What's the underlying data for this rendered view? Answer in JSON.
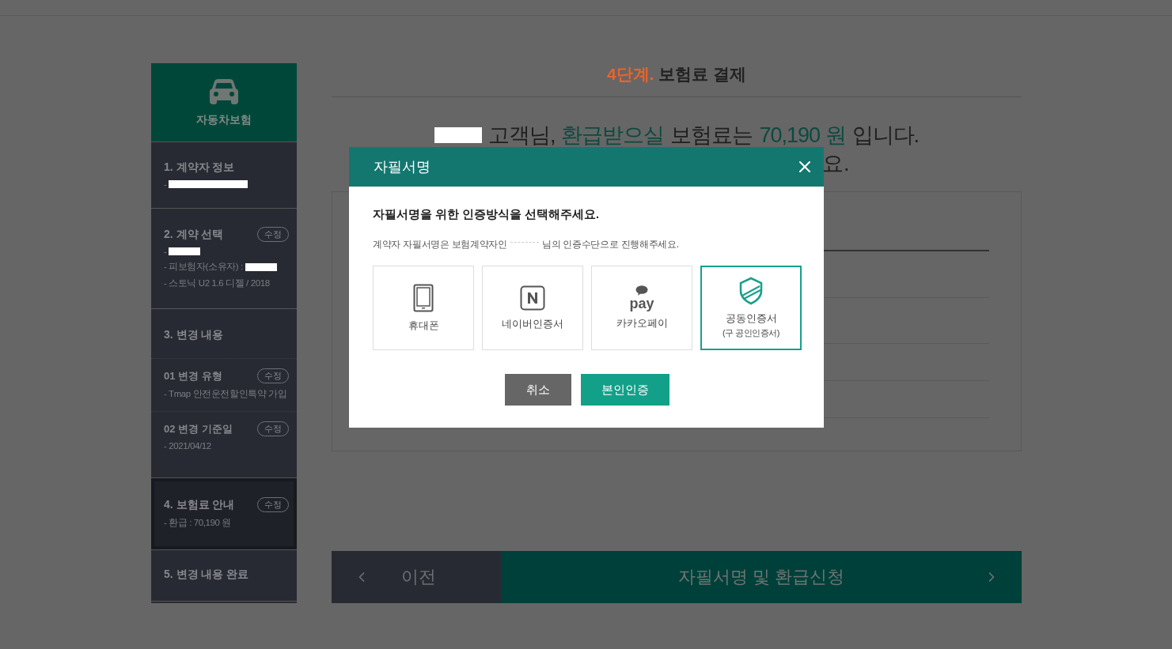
{
  "sidebar": {
    "title": "자동차보험",
    "sections": [
      {
        "title": "1. 계약자 정보",
        "active": false,
        "lines": [
          {
            "text": "-",
            "redacted": true
          }
        ]
      },
      {
        "title": "2. 계약 선택",
        "edit": "수정",
        "active": false,
        "lines": [
          {
            "text": "-",
            "redacted": true
          },
          {
            "text": "- 피보험자(소유자) :",
            "redacted": true
          },
          {
            "text": "- 스토닉 U2 1.6 디젤 / 2018",
            "redacted": false
          }
        ]
      },
      {
        "title": "3. 변경 내용",
        "active": false,
        "children": [
          {
            "title": "01 변경 유형",
            "edit": "수정",
            "lines": [
              {
                "text": "- Tmap 안전운전할인특약 가입",
                "redacted": false
              }
            ]
          },
          {
            "title": "02 변경 기준일",
            "edit": "수정",
            "lines": [
              {
                "text": "- 2021/04/12",
                "redacted": false
              }
            ]
          }
        ]
      },
      {
        "title": "4. 보험료 안내",
        "edit": "수정",
        "active": true,
        "lines": [
          {
            "text": "- 환급 : 70,190 원",
            "redacted": false
          }
        ]
      },
      {
        "title": "5. 변경 내용 완료",
        "active": false
      }
    ]
  },
  "main": {
    "step_label": "4단계.",
    "step_title": "보험료 결제",
    "message": [
      {
        "kind": "plain",
        "text": "고객님,"
      },
      {
        "kind": "highlight",
        "text": "환급받으실"
      },
      {
        "kind": "plain",
        "text": "보험료는"
      },
      {
        "kind": "highlight",
        "text": "70,190 원"
      },
      {
        "kind": "plain",
        "text": "입니다."
      }
    ],
    "message_line_2": "요."
  },
  "modal": {
    "title": "자필서명",
    "heading": "자필서명을 위한 인증방식을 선택해주세요.",
    "note": [
      "계약자 자필서명은 보험계약자인",
      "님의 인증수단으로 진행해주세요."
    ],
    "options": [
      {
        "kind": "phone",
        "label": "휴대폰",
        "selected": false
      },
      {
        "kind": "naver",
        "label": "네이버인증서",
        "selected": false
      },
      {
        "kind": "kakao",
        "label": "카카오페이",
        "mark": "pay",
        "selected": false
      },
      {
        "kind": "certificate",
        "label": "공동인증서",
        "sublabel": "(구 공인인증서)",
        "selected": true
      }
    ],
    "buttons": [
      {
        "kind": "cancel",
        "label": "취소"
      },
      {
        "kind": "confirm",
        "label": "본인인증"
      }
    ]
  },
  "nav": {
    "prev": "이전",
    "next": "자필서명 및 환급신청"
  }
}
